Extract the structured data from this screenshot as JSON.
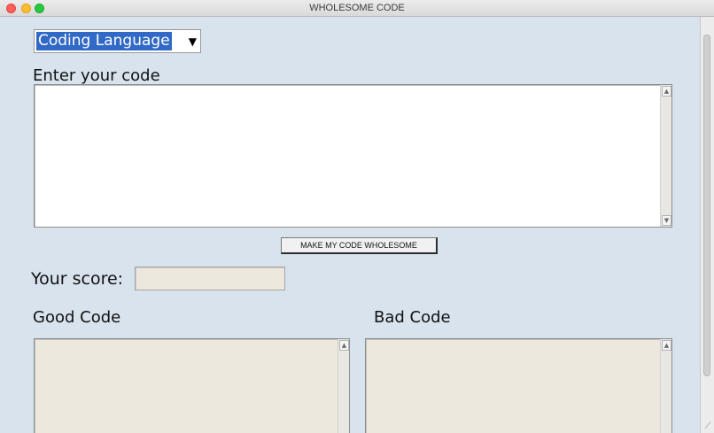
{
  "window": {
    "title": "WHOLESOME CODE"
  },
  "language_select": {
    "selected": "Coding Language",
    "arrow_icon": "triangle-down-icon"
  },
  "code_input": {
    "label": "Enter your code",
    "value": ""
  },
  "wholesome_button": {
    "label": "MAKE MY CODE WHOLESOME"
  },
  "score": {
    "label": "Your score:",
    "value": ""
  },
  "good_code": {
    "label": "Good Code",
    "value": ""
  },
  "bad_code": {
    "label": "Bad Code",
    "value": ""
  },
  "colors": {
    "background": "#d8e3ee",
    "selection": "#3169c6",
    "readonly_field": "#ece8dd"
  }
}
